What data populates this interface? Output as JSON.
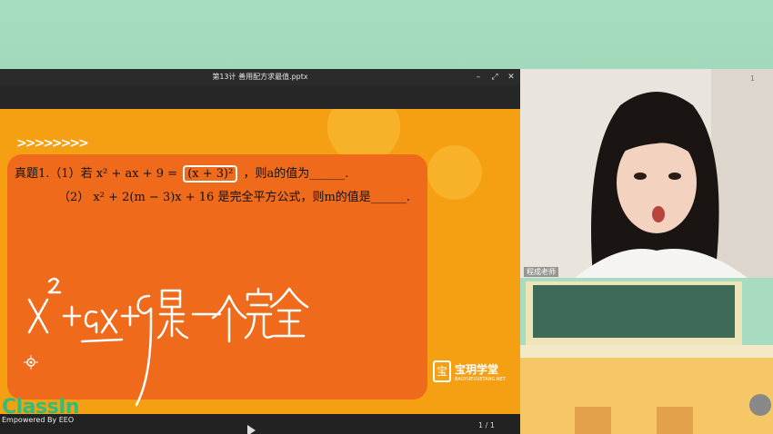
{
  "window": {
    "title": "第13计 善用配方求最值.pptx",
    "controls": {
      "minimize": "–",
      "restore": "⤢",
      "close": "✕"
    }
  },
  "slide": {
    "q1_prefix": "真题1.（1）若",
    "q1_expr": "x² + ax + 9 =",
    "q1_boxed": "(x + 3)²",
    "q1_suffix": "，则a的值为______.",
    "q2_prefix": "（2）",
    "q2_expr": "x² + 2(m − 3)x + 16",
    "q2_suffix": "是完全平方公式，则m的值是______.",
    "handwriting": "x²+ax+9 是一个完全",
    "logo_text": "宝玥学堂",
    "logo_sub": "BAOYUEXUETANG.NET"
  },
  "pager": "1 / 1",
  "classin": {
    "name": "ClassIn",
    "sub": "Empowered By EEO"
  },
  "video": {
    "teacher_label": "程成老师",
    "corner": "1"
  },
  "colors": {
    "slide_bg": "#f5a012",
    "card": "#f06a1b",
    "wallpaper": "#a6dcbf",
    "brand_green": "#2fbf7a"
  }
}
